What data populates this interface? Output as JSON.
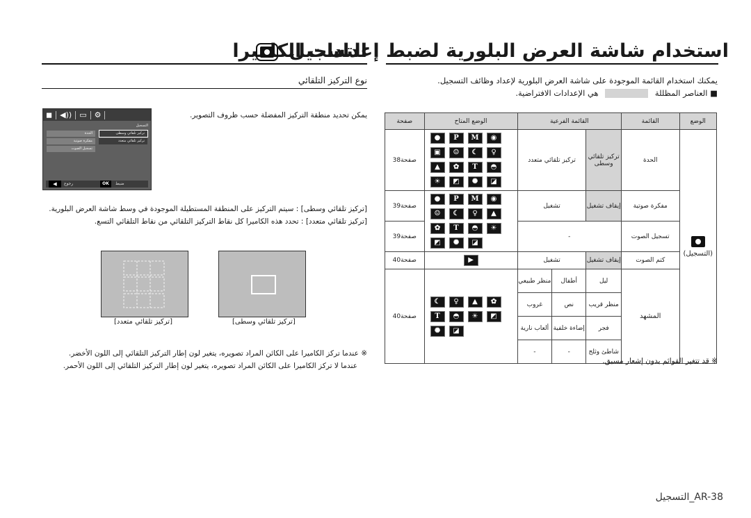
{
  "right_title": "استخدام شاشة العرض البلورية لضبط إعدادات الكاميرا",
  "left_title": "التسجيل",
  "left_title_icon": "camera-icon",
  "left_subtitle": "نوع التركيز التلقائي",
  "intro_line1": "يمكنك استخدام القائمة الموجودة على شاشة العرض البلورية لإعداد وظائف التسجيل.",
  "legend_prefix": "■ العناصر المظللة",
  "legend_suffix": "هي الإعدادات الافتراضية.",
  "table": {
    "headers": {
      "mode": "الوضع",
      "menu": "القائمة",
      "submenu": "القائمة الفرعية",
      "available": "الوضع المتاح",
      "page": "صفحة"
    },
    "mode_label": "(التسجيل)",
    "rows": [
      {
        "menu": "الحدة",
        "sub_default": "تركيز تلقائي وسطى",
        "sub_other": "تركيز تلقائي متعدد",
        "page": "صفحة38"
      },
      {
        "menu": "مفكرة صوتية",
        "sub_default": "إيقاف تشغيل",
        "sub_other": "تشغيل",
        "page": "صفحة39"
      },
      {
        "menu": "تسجيل الصوت",
        "sub_single": "-",
        "page": "صفحة39"
      },
      {
        "menu": "كتم الصوت",
        "sub_default": "إيقاف تشغيل",
        "sub_other": "تشغيل",
        "page": "صفحة40"
      },
      {
        "menu": "المشهد",
        "page": "صفحة40",
        "scenes": [
          [
            "ليل",
            "أطفال",
            "منظر طبيعي"
          ],
          [
            "منظر قريب",
            "نص",
            "غروب"
          ],
          [
            "فجر",
            "إضاءة خلفية",
            "ألعاب نارية"
          ],
          [
            "شاطئ وثلج",
            "-",
            "-"
          ]
        ]
      }
    ],
    "icons_row1": [
      "camera",
      "program",
      "M",
      "dis",
      "movie-fix",
      "portrait",
      "night",
      "kids",
      "landscape",
      "closeup",
      "text",
      "sunset",
      "dawn",
      "backlight",
      "firework",
      "beach"
    ],
    "icons_row2": [
      "camera",
      "program",
      "M",
      "dis",
      "portrait",
      "night",
      "kids",
      "landscape",
      "closeup",
      "text",
      "sunset",
      "dawn",
      "backlight",
      "firework",
      "beach"
    ],
    "icons_row4": [
      "movie"
    ],
    "icons_row5": [
      "night",
      "kids",
      "landscape",
      "closeup",
      "text",
      "sunset",
      "dawn",
      "backlight",
      "firework",
      "beach"
    ]
  },
  "footnote_right": "※ قد تتغير القوائم بدون إشعار مسبق.",
  "focus_intro": "يمكن تحديد منطقة التركيز المفضلة حسب ظروف التصوير.",
  "def_center_label": "[تركيز تلقائي وسطى]",
  "def_center_text": ": سيتم التركيز على المنطقة المستطيلة الموجودة في وسط شاشة العرض البلورية.",
  "def_multi_label": "[تركيز تلقائي متعدد]",
  "def_multi_text": ": تحدد هذه الكاميرا كل نقاط التركيز التلقائي من نقاط التلقائي التسع.",
  "caption_multi": "[تركيز تلقائي متعدد]",
  "caption_center": "[تركيز تلقائي وسطى]",
  "note_line1": "※ عندما تركز الكاميرا على الكائن المراد تصويره، يتغير لون إطار التركيز التلقائي إلى اللون الأخضر.",
  "note_line2": "عندما لا تركز الكاميرا على الكائن المراد تصويره، يتغير لون إطار التركيز التلقائي إلى اللون الأحمر.",
  "lcd": {
    "header": "التسجيل",
    "left_items": [
      "الحدة",
      "مفكرة صوتية",
      "تسجيل الصوت"
    ],
    "right_items": [
      "تركيز تلقائي وسطى",
      "تركيز تلقائي متعدد"
    ],
    "back_label": "رجوع",
    "ok_label": "OK",
    "set_label": "ضبط"
  },
  "page_footer": "AR-38_التسجيل"
}
